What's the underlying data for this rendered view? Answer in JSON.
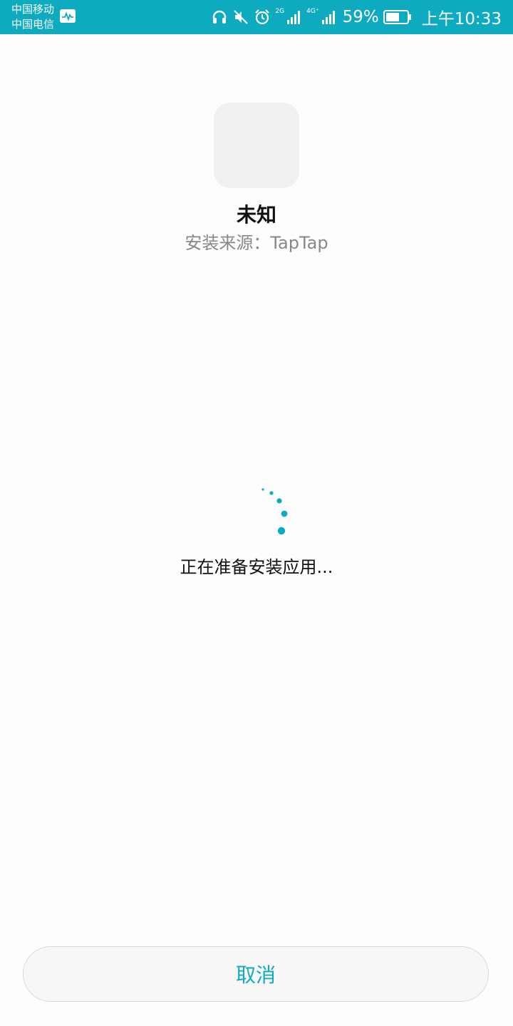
{
  "status_bar": {
    "carrier_1": "中国移动",
    "carrier_2": "中国电信",
    "network_2g": "2G",
    "network_4g": "4G⁺",
    "battery_percent": "59%",
    "time": "上午10:33",
    "background_color": "#0eabc0",
    "icons": [
      "activity-monitor-icon",
      "headset-icon",
      "mute-icon",
      "alarm-icon",
      "signal-icon",
      "battery-icon"
    ]
  },
  "app": {
    "name": "未知",
    "source_label": "安装来源：",
    "source_value": "TapTap"
  },
  "progress": {
    "message": "正在准备安装应用...",
    "spinner_color": "#0eabc0"
  },
  "actions": {
    "cancel_label": "取消",
    "accent_color": "#0eabc0"
  }
}
